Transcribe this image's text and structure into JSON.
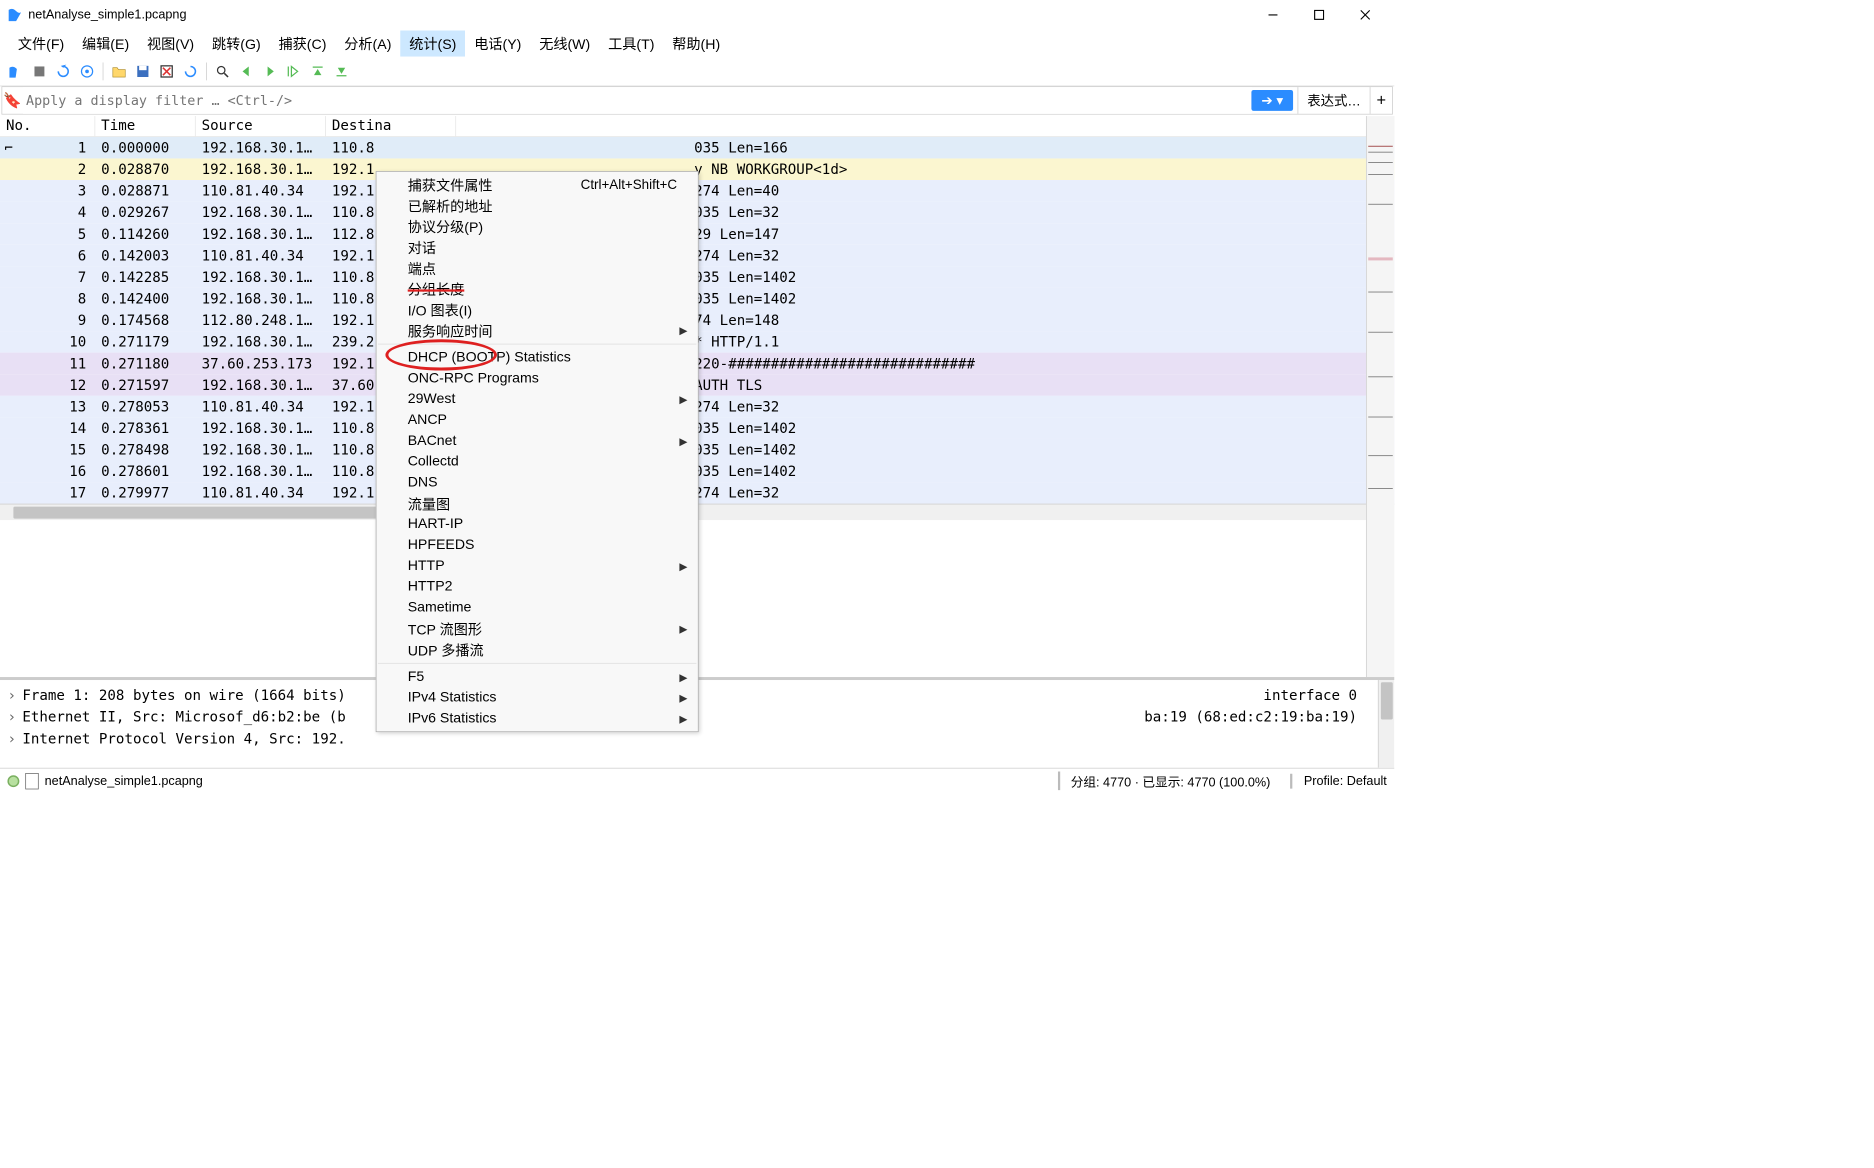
{
  "window": {
    "title": "netAnalyse_simple1.pcapng"
  },
  "menubar": [
    "文件(F)",
    "编辑(E)",
    "视图(V)",
    "跳转(G)",
    "捕获(C)",
    "分析(A)",
    "统计(S)",
    "电话(Y)",
    "无线(W)",
    "工具(T)",
    "帮助(H)"
  ],
  "active_menu_index": 6,
  "filter": {
    "placeholder": "Apply a display filter … <Ctrl-/>",
    "expr_btn": "表达式…"
  },
  "columns": {
    "no": "No.",
    "time": "Time",
    "src": "Source",
    "dst": "Destina"
  },
  "packets": [
    {
      "no": "1",
      "time": "0.000000",
      "src": "192.168.30.1…",
      "dst": "110.8",
      "info": "035 Len=166",
      "bg": "sel",
      "selected": true
    },
    {
      "no": "2",
      "time": "0.028870",
      "src": "192.168.30.1…",
      "dst": "192.1",
      "info": "y NB WORKGROUP<1d>",
      "bg": "bg-yellow"
    },
    {
      "no": "3",
      "time": "0.028871",
      "src": "110.81.40.34",
      "dst": "192.1",
      "info": "274 Len=40",
      "bg": "bg-blue"
    },
    {
      "no": "4",
      "time": "0.029267",
      "src": "192.168.30.1…",
      "dst": "110.8",
      "info": "035 Len=32",
      "bg": "bg-blue"
    },
    {
      "no": "5",
      "time": "0.114260",
      "src": "192.168.30.1…",
      "dst": "112.8",
      "info": "29 Len=147",
      "bg": "bg-blue"
    },
    {
      "no": "6",
      "time": "0.142003",
      "src": "110.81.40.34",
      "dst": "192.1",
      "info": "274 Len=32",
      "bg": "bg-blue"
    },
    {
      "no": "7",
      "time": "0.142285",
      "src": "192.168.30.1…",
      "dst": "110.8",
      "info": "035 Len=1402",
      "bg": "bg-blue"
    },
    {
      "no": "8",
      "time": "0.142400",
      "src": "192.168.30.1…",
      "dst": "110.8",
      "info": "035 Len=1402",
      "bg": "bg-blue"
    },
    {
      "no": "9",
      "time": "0.174568",
      "src": "112.80.248.1…",
      "dst": "192.1",
      "info": "74 Len=148",
      "bg": "bg-blue"
    },
    {
      "no": "10",
      "time": "0.271179",
      "src": "192.168.30.1…",
      "dst": "239.2",
      "info": "* HTTP/1.1",
      "bg": "bg-blue"
    },
    {
      "no": "11",
      "time": "0.271180",
      "src": "37.60.253.173",
      "dst": "192.1",
      "info": "  220-#############################",
      "bg": "bg-purple"
    },
    {
      "no": "12",
      "time": "0.271597",
      "src": "192.168.30.1…",
      "dst": "37.60",
      "info": "AUTH TLS",
      "bg": "bg-purple"
    },
    {
      "no": "13",
      "time": "0.278053",
      "src": "110.81.40.34",
      "dst": "192.1",
      "info": "274 Len=32",
      "bg": "bg-blue"
    },
    {
      "no": "14",
      "time": "0.278361",
      "src": "192.168.30.1…",
      "dst": "110.8",
      "info": "035 Len=1402",
      "bg": "bg-blue"
    },
    {
      "no": "15",
      "time": "0.278498",
      "src": "192.168.30.1…",
      "dst": "110.8",
      "info": "035 Len=1402",
      "bg": "bg-blue"
    },
    {
      "no": "16",
      "time": "0.278601",
      "src": "192.168.30.1…",
      "dst": "110.8",
      "info": "035 Len=1402",
      "bg": "bg-blue"
    },
    {
      "no": "17",
      "time": "0.279977",
      "src": "110.81.40.34",
      "dst": "192.1",
      "info": "274 Len=32",
      "bg": "bg-blue"
    }
  ],
  "dropdown": {
    "groups": [
      [
        {
          "label": "捕获文件属性",
          "shortcut": "Ctrl+Alt+Shift+C"
        },
        {
          "label": "已解析的地址"
        },
        {
          "label": "协议分级(P)"
        },
        {
          "label": "对话"
        },
        {
          "label": "端点"
        },
        {
          "label": "分组长度",
          "strike": true
        },
        {
          "label": "I/O 图表(I)",
          "circled": true
        },
        {
          "label": "服务响应时间",
          "sub": true
        }
      ],
      [
        {
          "label": "DHCP (BOOTP) Statistics"
        },
        {
          "label": "ONC-RPC Programs"
        },
        {
          "label": "29West",
          "sub": true
        },
        {
          "label": "ANCP"
        },
        {
          "label": "BACnet",
          "sub": true
        },
        {
          "label": "Collectd"
        },
        {
          "label": "DNS"
        },
        {
          "label": "流量图"
        },
        {
          "label": "HART-IP"
        },
        {
          "label": "HPFEEDS"
        },
        {
          "label": "HTTP",
          "sub": true
        },
        {
          "label": "HTTP2"
        },
        {
          "label": "Sametime"
        },
        {
          "label": "TCP 流图形",
          "sub": true
        },
        {
          "label": "UDP 多播流"
        }
      ],
      [
        {
          "label": "F5",
          "sub": true
        },
        {
          "label": "IPv4 Statistics",
          "sub": true
        },
        {
          "label": "IPv6 Statistics",
          "sub": true
        }
      ]
    ]
  },
  "details": [
    "Frame 1: 208 bytes on wire (1664 bits)",
    "Ethernet II, Src: Microsof_d6:b2:be (b",
    "Internet Protocol Version 4, Src: 192."
  ],
  "details_right": [
    "interface 0",
    "ba:19 (68:ed:c2:19:ba:19)",
    ""
  ],
  "status": {
    "file": "netAnalyse_simple1.pcapng",
    "packets": "分组: 4770 · 已显示: 4770 (100.0%)",
    "profile": "Profile: Default"
  }
}
